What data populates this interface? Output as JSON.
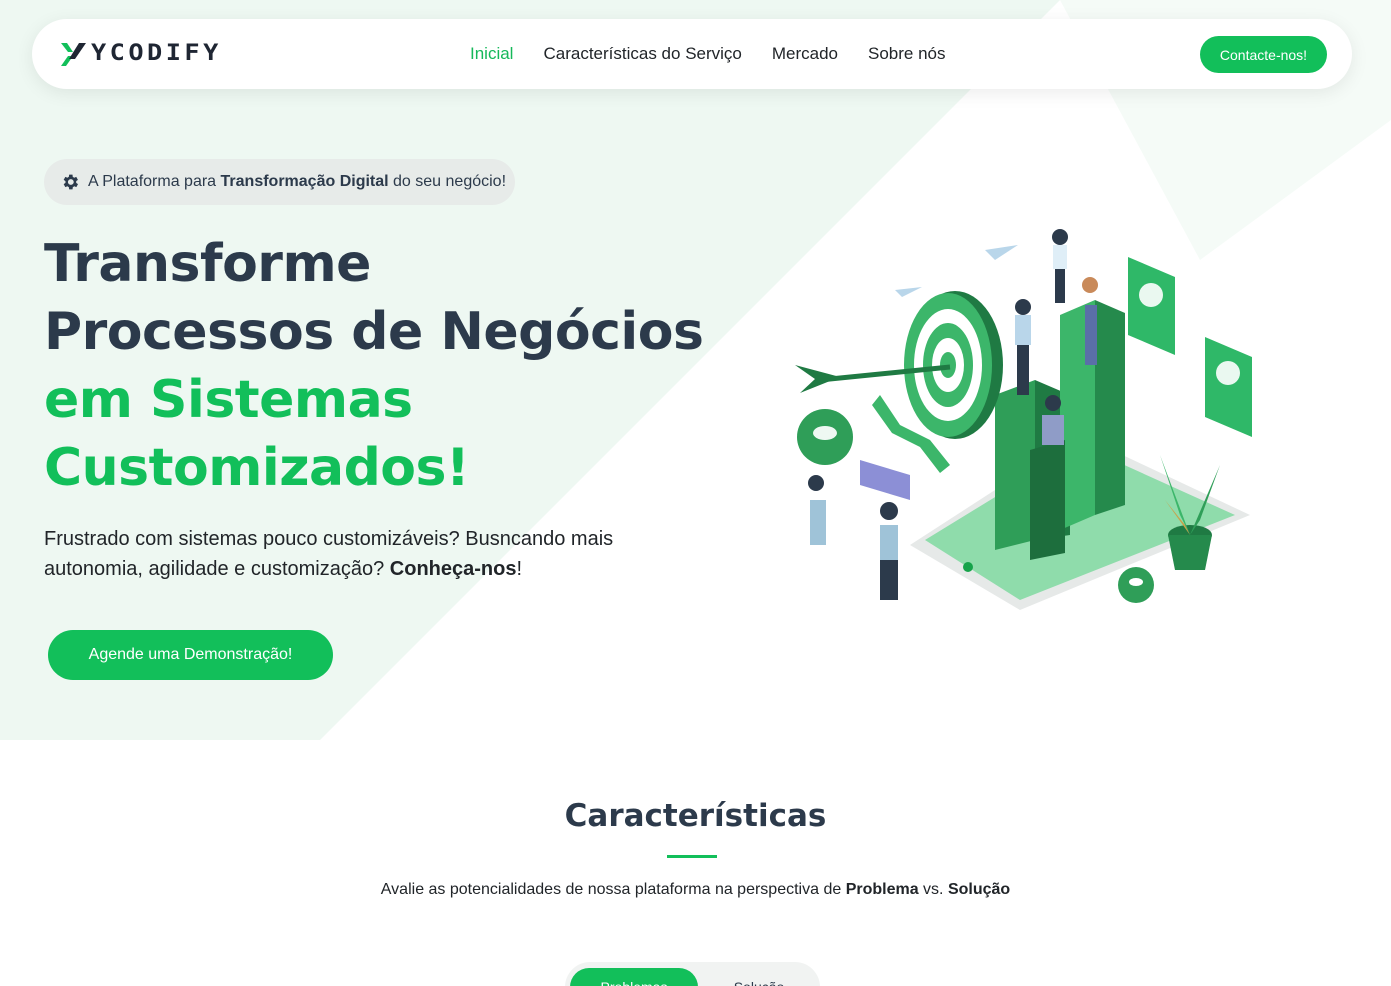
{
  "brand": {
    "name": "YCODIFY"
  },
  "nav": {
    "items": [
      {
        "label": "Inicial",
        "active": true
      },
      {
        "label": "Características do Serviço",
        "active": false
      },
      {
        "label": "Mercado",
        "active": false
      },
      {
        "label": "Sobre nós",
        "active": false
      }
    ],
    "contact_label": "Contacte-nos!"
  },
  "hero": {
    "badge": {
      "pre": "A Plataforma para ",
      "bold": "Transformação Digital",
      "post": " do seu negócio!",
      "icon": "gear-icon"
    },
    "headline": {
      "line1": "Transforme",
      "line2": "Processos de Negócios",
      "line3": "em Sistemas",
      "line4": "Customizados!"
    },
    "subtext": {
      "main": "Frustrado com sistemas pouco customizáveis? Busncando mais autonomia, agilidade e customização? ",
      "bold": "Conheça-nos",
      "end": "!"
    },
    "cta_label": "Agende uma Demonstração!"
  },
  "features": {
    "title": "Características",
    "subtitle": {
      "pre": "Avalie as potencialidades de nossa plataforma na perspectiva de ",
      "b1": "Problema",
      "mid": " vs. ",
      "b2": "Solução"
    },
    "tabs": [
      {
        "label": "Problemas",
        "active": true
      },
      {
        "label": "Solução",
        "active": false
      }
    ]
  },
  "colors": {
    "accent": "#12bf5a",
    "dark_text": "#2c3a4b",
    "hero_tint": "#eef8f2"
  }
}
